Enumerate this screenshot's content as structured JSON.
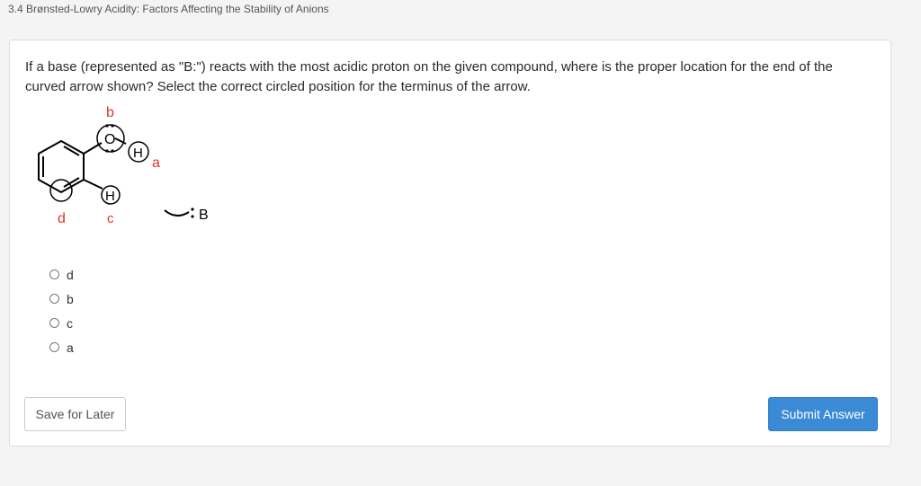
{
  "header": {
    "title": "3.4 Brønsted-Lowry Acidity: Factors Affecting the Stability of Anions"
  },
  "question": {
    "text": "If a base (represented as \"B:\") reacts with the most acidic proton on the given compound, where is the proper location for the end of the curved arrow shown? Select the correct circled position for the terminus of the arrow."
  },
  "figure": {
    "labels": {
      "a": "a",
      "b": "b",
      "c": "c",
      "d": "d"
    },
    "atoms": {
      "oxygen": "O",
      "hydrogen_hydroxyl": "H",
      "hydrogen_ring": "H",
      "base": "B"
    },
    "label_color": "#e0342a"
  },
  "options": [
    {
      "label": "d"
    },
    {
      "label": "b"
    },
    {
      "label": "c"
    },
    {
      "label": "a"
    }
  ],
  "buttons": {
    "save_label": "Save for Later",
    "submit_label": "Submit Answer"
  },
  "colors": {
    "accent": "#3a8ad6"
  }
}
